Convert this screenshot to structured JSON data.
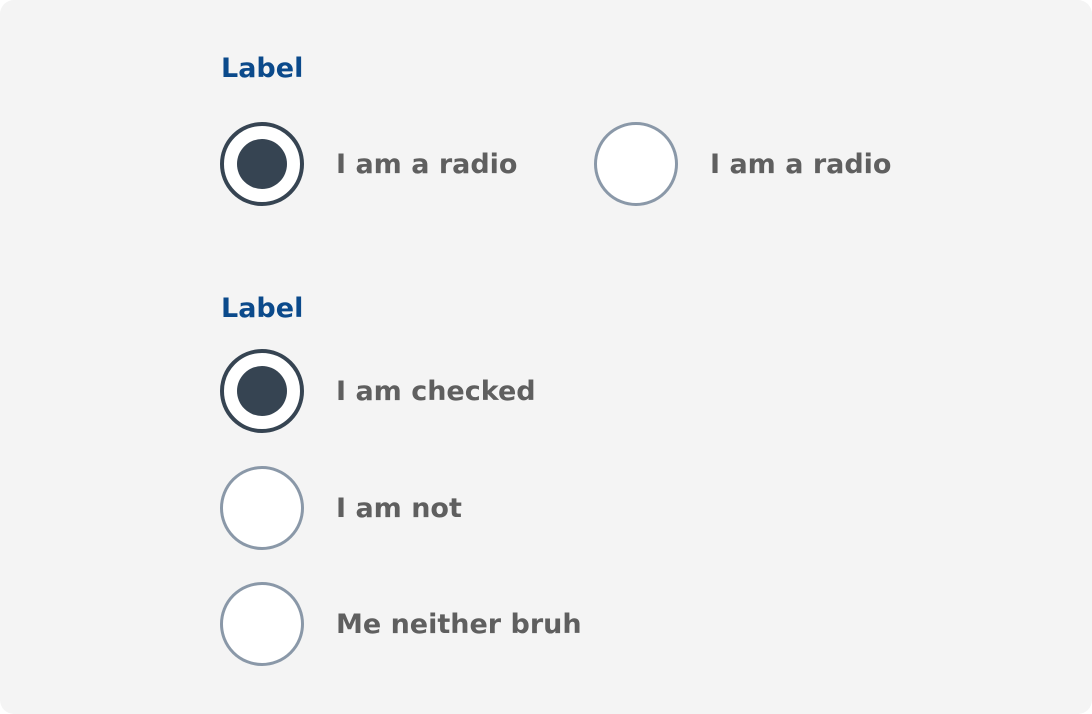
{
  "group1": {
    "label": "Label",
    "options": [
      {
        "text": "I am a radio",
        "checked": true
      },
      {
        "text": "I am a radio",
        "checked": false
      }
    ]
  },
  "group2": {
    "label": "Label",
    "options": [
      {
        "text": "I am checked",
        "checked": true
      },
      {
        "text": "I am not",
        "checked": false
      },
      {
        "text": "Me neither bruh",
        "checked": false
      }
    ]
  },
  "colors": {
    "background": "#f4f4f4",
    "label": "#0b4a8b",
    "radio_checked": "#364452",
    "radio_unchecked_border": "#8a98a8",
    "option_text": "#5f5f5f"
  }
}
